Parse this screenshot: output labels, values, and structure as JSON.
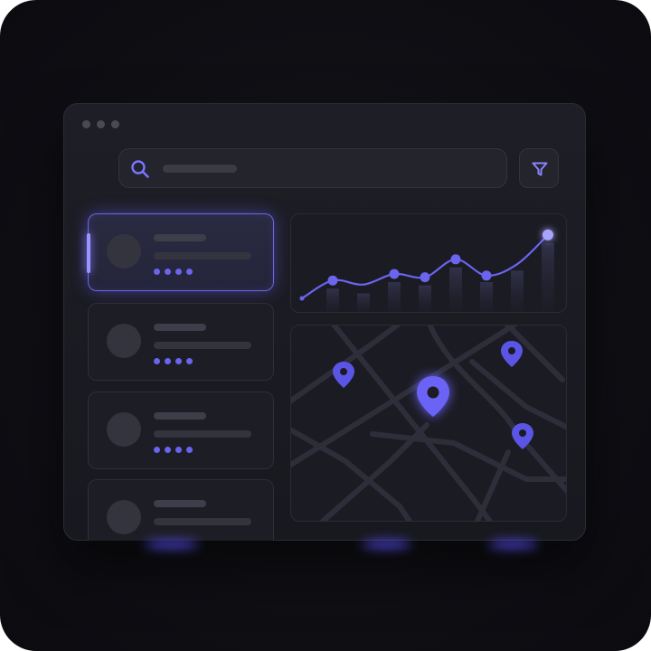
{
  "colors": {
    "accent": "#6a64ee",
    "accent_bright": "#a9a5ff",
    "background": "#0f0f14",
    "window": "#1c1c24"
  },
  "window": {
    "controls": [
      "dot",
      "dot",
      "dot"
    ]
  },
  "search": {
    "icon": "search-icon",
    "placeholder": ""
  },
  "filter": {
    "icon": "filter-icon"
  },
  "list": {
    "items": [
      {
        "selected": true,
        "rating": 4
      },
      {
        "selected": false,
        "rating": 4
      },
      {
        "selected": false,
        "rating": 4
      },
      {
        "selected": false,
        "rating": 0
      }
    ]
  },
  "chart_data": {
    "type": "line",
    "title": "",
    "xlabel": "",
    "ylabel": "",
    "x": [
      0,
      1,
      2,
      3,
      4,
      5,
      6,
      7,
      8
    ],
    "values": [
      10,
      32,
      27,
      40,
      36,
      58,
      38,
      52,
      88
    ],
    "marked_points": [
      1,
      3,
      4,
      5,
      6,
      8
    ],
    "bars": [
      8,
      22,
      16,
      30,
      26,
      48,
      30,
      44,
      78
    ],
    "ylim": [
      0,
      100
    ],
    "grid": false,
    "legend": "none"
  },
  "map": {
    "markers": [
      {
        "icon": "map-pin-icon",
        "highlighted": false
      },
      {
        "icon": "map-pin-icon",
        "highlighted": true
      },
      {
        "icon": "map-pin-icon",
        "highlighted": false
      },
      {
        "icon": "map-pin-icon",
        "highlighted": false
      }
    ]
  }
}
